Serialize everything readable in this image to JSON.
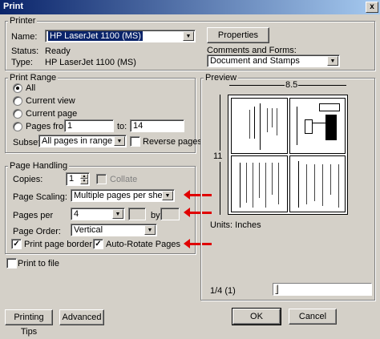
{
  "window": {
    "title": "Print",
    "close_glyph": "x"
  },
  "printer": {
    "group_label": "Printer",
    "name_label": "Name:",
    "name_value": "HP LaserJet 1100 (MS)",
    "properties_label": "Properties",
    "status_label": "Status:",
    "status_value": "Ready",
    "type_label": "Type:",
    "type_value": "HP LaserJet 1100 (MS)",
    "comments_label": "Comments and Forms:",
    "comments_value": "Document and Stamps"
  },
  "print_range": {
    "group_label": "Print Range",
    "all_label": "All",
    "current_view_label": "Current view",
    "current_page_label": "Current page",
    "pages_from_label": "Pages from:",
    "from_value": "1",
    "to_label": "to:",
    "to_value": "14",
    "subset_label": "Subset:",
    "subset_value": "All pages in range",
    "reverse_label": "Reverse pages"
  },
  "page_handling": {
    "group_label": "Page Handling",
    "copies_label": "Copies:",
    "copies_value": "1",
    "collate_label": "Collate",
    "scaling_label": "Page Scaling:",
    "scaling_value": "Multiple pages per sheet",
    "pages_per_label": "Pages per",
    "pages_per_value": "4",
    "by_label": "by",
    "order_label": "Page Order:",
    "order_value": "Vertical",
    "border_label": "Print page border",
    "autorotate_label": "Auto-Rotate Pages",
    "check_glyph": "✓"
  },
  "print_to_file_label": "Print to file",
  "preview": {
    "group_label": "Preview",
    "width_label": "8.5",
    "height_label": "11",
    "units_label": "Units: Inches",
    "page_label": "1/4 (1)"
  },
  "buttons": {
    "printing_tips": "Printing Tips",
    "advanced": "Advanced",
    "ok": "OK",
    "cancel": "Cancel"
  },
  "colors": {
    "title_bar": "#0a246a",
    "highlight": "#0a246a",
    "arrow": "#e00000",
    "face": "#d4d0c8"
  }
}
